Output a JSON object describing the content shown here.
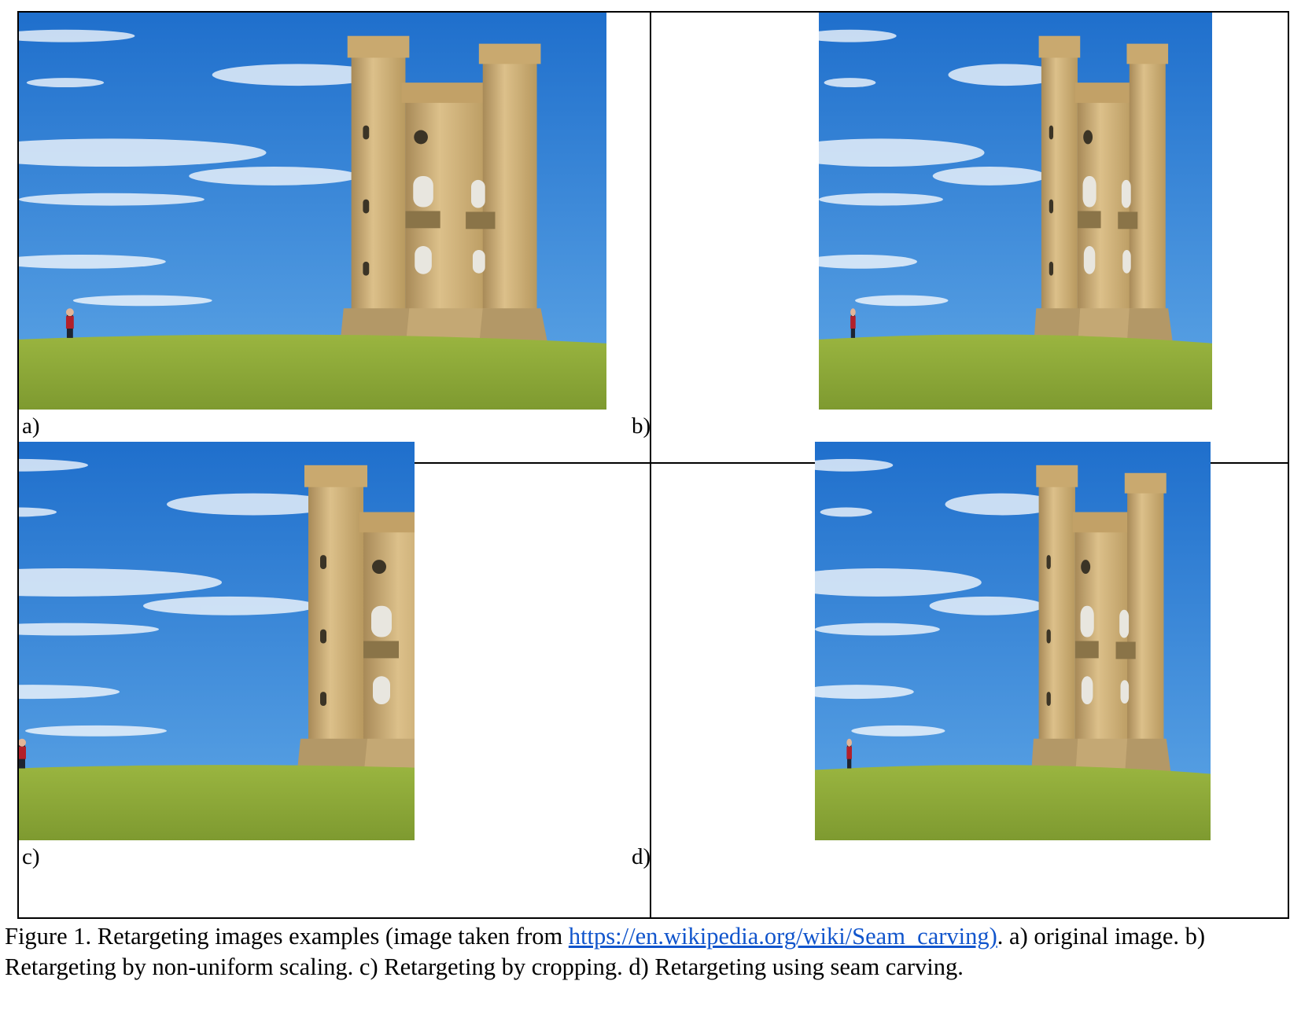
{
  "panels": [
    {
      "label": "a)"
    },
    {
      "label": "b)"
    },
    {
      "label": "c)"
    },
    {
      "label": "d)"
    }
  ],
  "caption": {
    "prefix": "Figure 1. Retargeting images examples (image taken from ",
    "link": "https://en.wikipedia.org/wiki/Seam_carving)",
    "suffix": ". a) original image. b) Retargeting by non-uniform scaling. c) Retargeting by cropping. d) Retargeting using seam carving."
  },
  "colors": {
    "sky": "#2f7fd3",
    "grass": "#8aa83a",
    "stone": "#cfb07a",
    "link": "#1155cc"
  }
}
